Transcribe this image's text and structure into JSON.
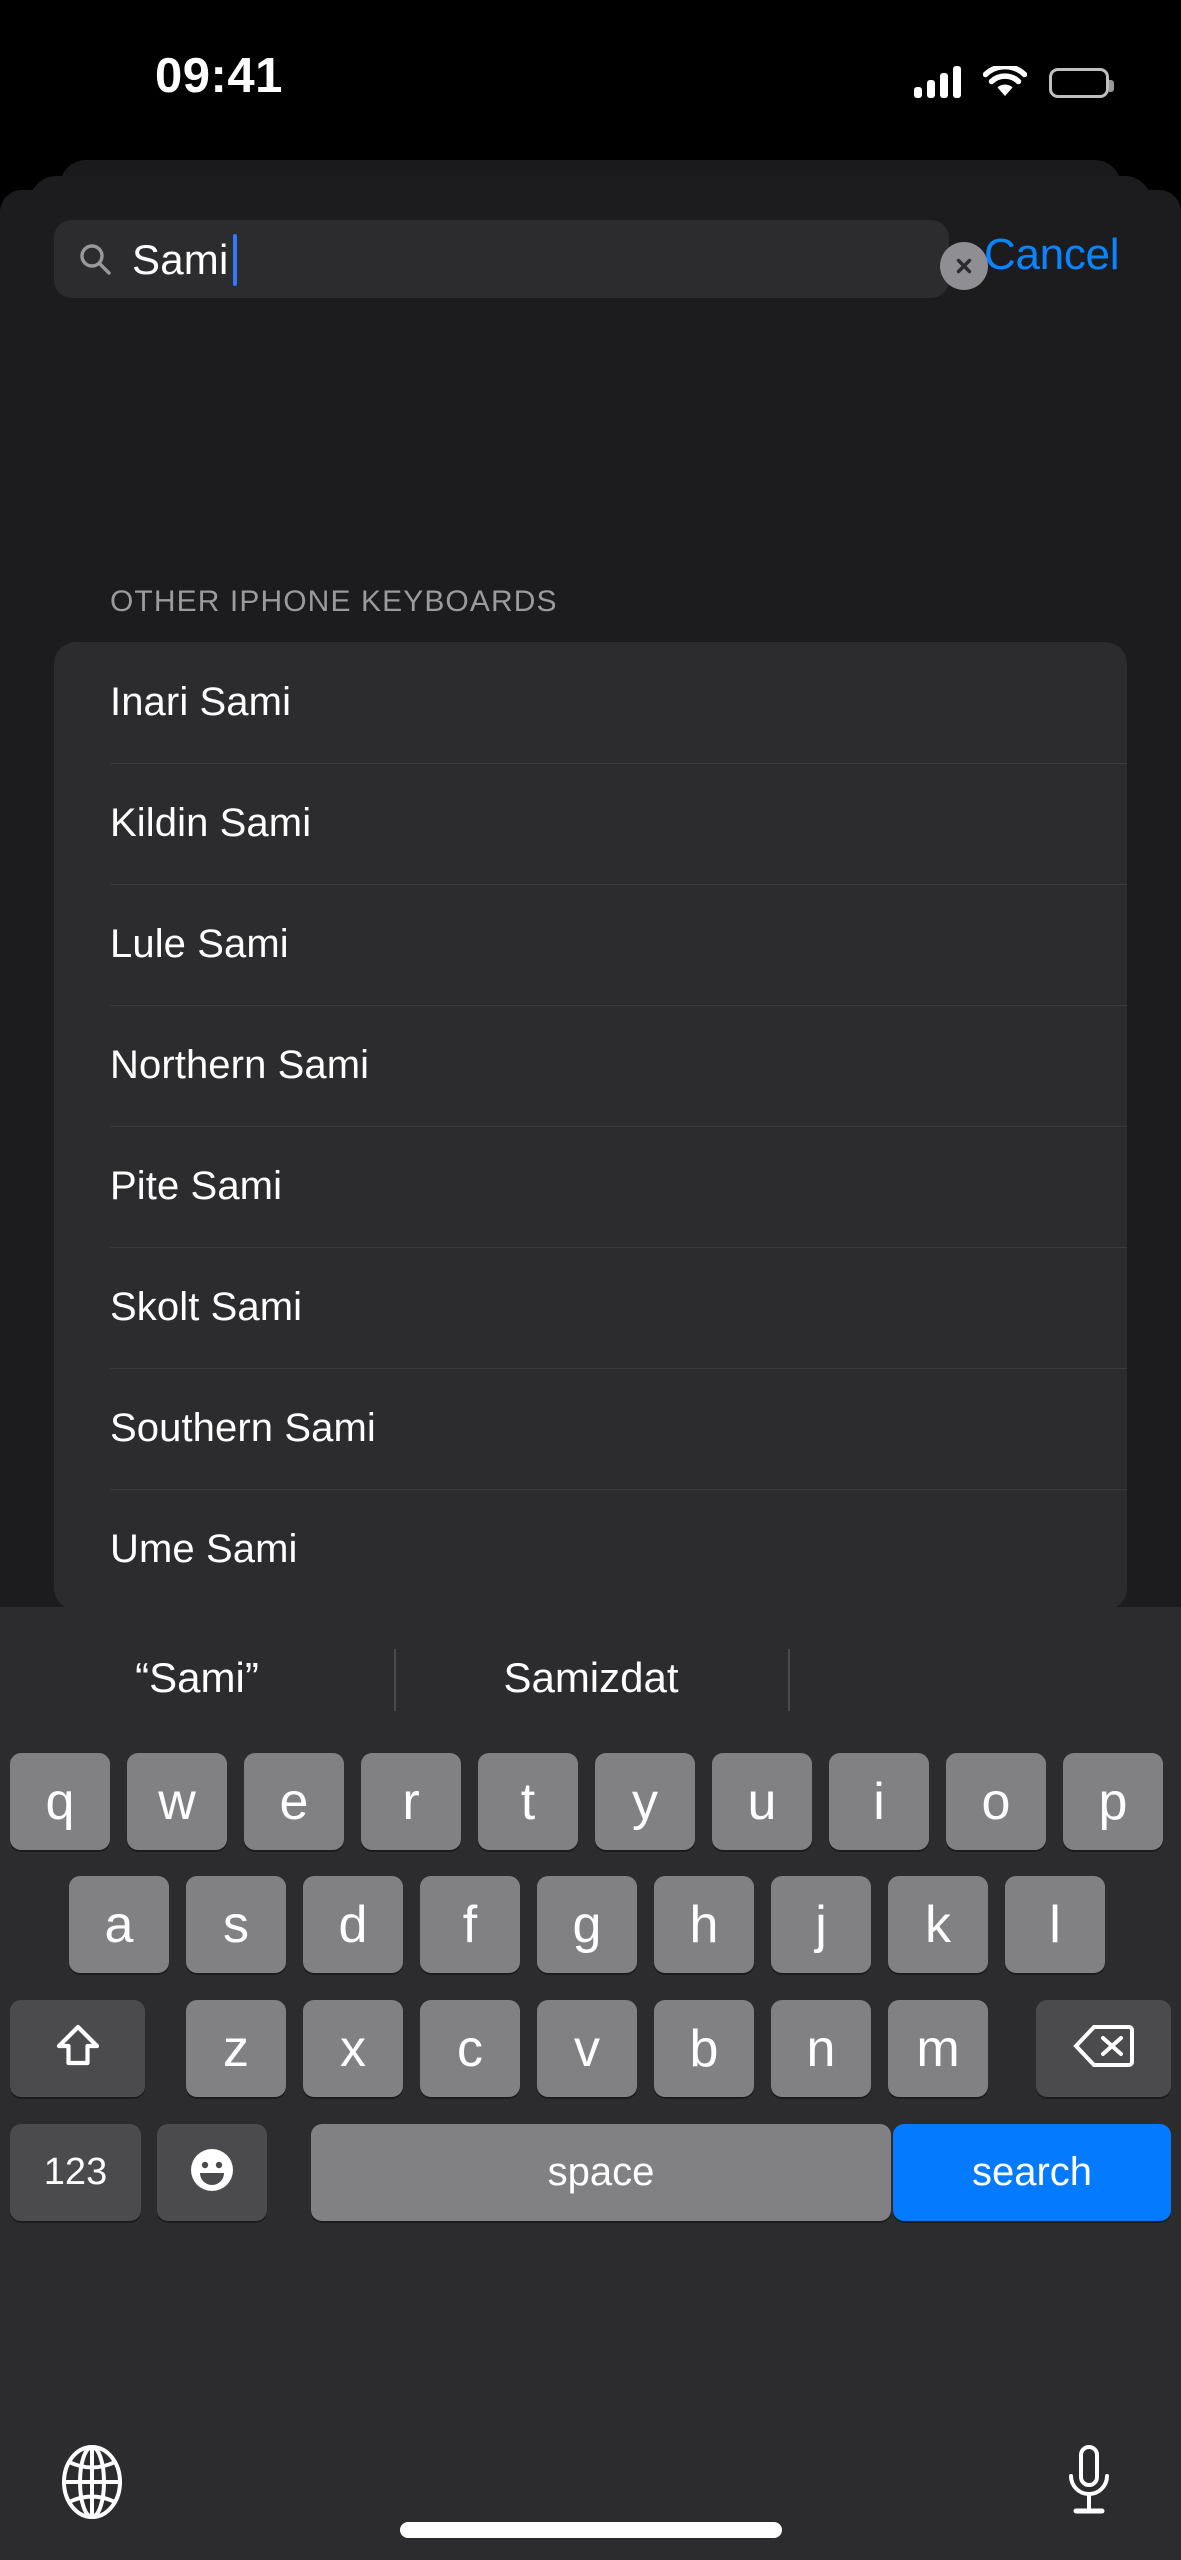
{
  "status_bar": {
    "time": "09:41",
    "cellular_icon": "cellular-signal-icon",
    "wifi_icon": "wifi-icon",
    "battery_icon": "battery-full-icon"
  },
  "search": {
    "value": "Sami",
    "placeholder": "Search",
    "search_icon": "search-icon",
    "clear_icon": "clear-text-icon",
    "cancel_label": "Cancel",
    "accent_color": "#0a84ff",
    "caret_color": "#3478f6"
  },
  "section": {
    "header": "OTHER IPHONE KEYBOARDS"
  },
  "list": {
    "items": [
      {
        "label": "Inari Sami"
      },
      {
        "label": "Kildin Sami"
      },
      {
        "label": "Lule Sami"
      },
      {
        "label": "Northern Sami"
      },
      {
        "label": "Pite Sami"
      },
      {
        "label": "Skolt Sami"
      },
      {
        "label": "Southern Sami"
      },
      {
        "label": "Ume Sami"
      }
    ]
  },
  "keyboard": {
    "predictions": [
      {
        "label": "“Sami”"
      },
      {
        "label": "Samizdat"
      },
      {
        "label": ""
      }
    ],
    "row1": [
      "q",
      "w",
      "e",
      "r",
      "t",
      "y",
      "u",
      "i",
      "o",
      "p"
    ],
    "row2": [
      "a",
      "s",
      "d",
      "f",
      "g",
      "h",
      "j",
      "k",
      "l"
    ],
    "row3": [
      "z",
      "x",
      "c",
      "v",
      "b",
      "n",
      "m"
    ],
    "shift_icon": "shift-arrow-icon",
    "backspace_icon": "backspace-delete-icon",
    "numbers_label": "123",
    "emoji_icon": "emoji-smiley-icon",
    "space_label": "space",
    "return_label": "search",
    "return_color": "#047aff",
    "globe_icon": "globe-language-icon",
    "mic_icon": "microphone-dictation-icon"
  }
}
